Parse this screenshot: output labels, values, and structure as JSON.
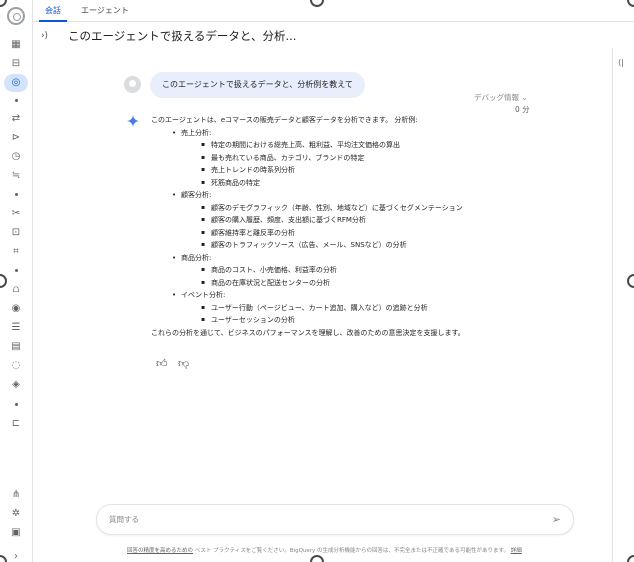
{
  "tabs": [
    {
      "label": "会話"
    },
    {
      "label": "エージェント"
    }
  ],
  "title": "このエージェントで扱えるデータと、分析...",
  "user_message": "このエージェントで扱えるデータと、分析例を教えて",
  "debug": {
    "label": "デバッグ情報 ⌄",
    "time": "0 分"
  },
  "answer": {
    "intro": "このエージェントは、eコマースの販売データと顧客データを分析できます。 分析例:",
    "sections": [
      {
        "title": "売上分析:",
        "items": [
          "特定の期間における総売上高、粗利益、平均注文価格の算出",
          "最も売れている商品、カテゴリ、ブランドの特定",
          "売上トレンドの時系列分析",
          "死筋商品の特定"
        ]
      },
      {
        "title": "顧客分析:",
        "items": [
          "顧客のデモグラフィック（年齢、性別、地域など）に基づくセグメンテーション",
          "顧客の購入履歴、頻度、支出額に基づくRFM分析",
          "顧客維持率と離反率の分析",
          "顧客のトラフィックソース（広告、メール、SNSなど）の分析"
        ]
      },
      {
        "title": "商品分析:",
        "items": [
          "商品のコスト、小売価格、利益率の分析",
          "商品の在庫状況と配送センターの分析"
        ]
      },
      {
        "title": "イベント分析:",
        "items": [
          "ユーザー行動（ページビュー、カート追加、購入など）の追跡と分析",
          "ユーザーセッションの分析"
        ]
      }
    ],
    "outro": "これらの分析を通じて、ビジネスのパフォーマンスを理解し、改善のための意思決定を支援します。"
  },
  "input": {
    "placeholder": "質問する"
  },
  "footer": {
    "link1": "回答の精度を高めるための",
    "middle": "ベスト プラクティスをご覧ください。BigQuery の生成分析機能からの回答は、不完全または不正確である可能性があります。",
    "link2": "詳細"
  },
  "icons": {
    "rail": [
      "logo-icon",
      "dashboard-icon",
      "table-icon",
      "agent-icon",
      "pipeline-icon",
      "transfer-icon",
      "schedule-icon",
      "filter-icon",
      "scissors-icon",
      "lock-icon",
      "scan-icon",
      "chart-icon",
      "explore-icon",
      "list-icon",
      "grid-icon",
      "monitor-icon",
      "settings-diamond-icon",
      "feedback-icon",
      "network-icon",
      "gear-icon",
      "notes-icon",
      "expand-icon"
    ]
  }
}
